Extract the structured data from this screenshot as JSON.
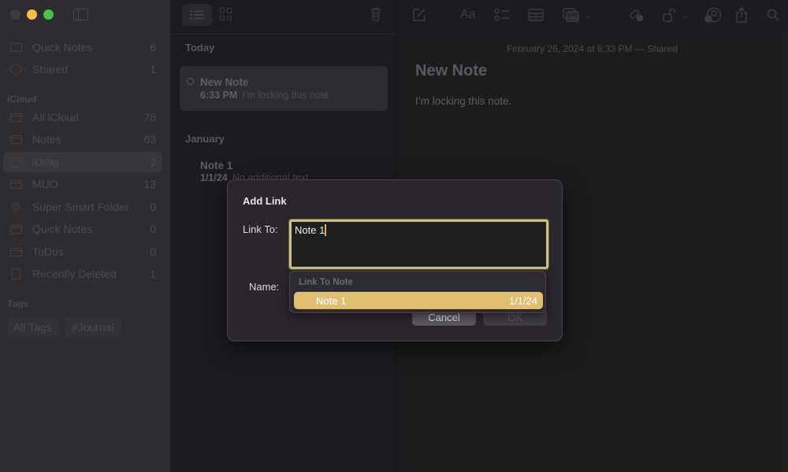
{
  "sidebar": {
    "pinned": [
      {
        "label": "Quick Notes",
        "count": "6",
        "icon": "quick-notes-icon"
      },
      {
        "label": "Shared",
        "count": "1",
        "icon": "shared-person-icon"
      }
    ],
    "section_icloud": "iCloud",
    "folders": [
      {
        "label": "All iCloud",
        "count": "78",
        "icon": "folder-icon"
      },
      {
        "label": "Notes",
        "count": "63",
        "icon": "folder-icon"
      },
      {
        "label": "iDrop",
        "count": "2",
        "icon": "folder-icon",
        "selected": true
      },
      {
        "label": "MUO",
        "count": "13",
        "icon": "folder-icon"
      },
      {
        "label": "Super Smart Folder",
        "count": "0",
        "icon": "gear-icon"
      },
      {
        "label": "Quick Notes",
        "count": "0",
        "icon": "folder-icon"
      },
      {
        "label": "ToDos",
        "count": "0",
        "icon": "folder-icon"
      },
      {
        "label": "Recently Deleted",
        "count": "1",
        "icon": "trash-icon"
      }
    ],
    "section_tags": "Tags",
    "tags": [
      "All Tags",
      "#Journal"
    ]
  },
  "notes_list": {
    "groups": [
      {
        "heading": "Today",
        "notes": [
          {
            "title": "New Note",
            "time": "6:33 PM",
            "preview": "I’m locking this note.",
            "shared": true
          }
        ]
      },
      {
        "heading": "January",
        "notes": [
          {
            "title": "Note 1",
            "time": "1/1/24",
            "preview": "No additional text"
          }
        ]
      }
    ]
  },
  "editor": {
    "meta": "February 26, 2024 at 6:33 PM — Shared",
    "title": "New Note",
    "body": "I’m locking this note.",
    "toolbar": [
      "compose-icon",
      "format-icon",
      "checklist-icon",
      "table-icon",
      "media-icon",
      "link-icon",
      "lock-icon",
      "collaborate-icon",
      "share-icon",
      "search-icon"
    ],
    "format_label": "Aa"
  },
  "dialog": {
    "title": "Add Link",
    "link_to_label": "Link To:",
    "link_to_value": "Note 1",
    "name_label": "Name:",
    "cancel_label": "Cancel",
    "ok_label": "OK",
    "suggestions": {
      "heading": "Link To Note",
      "items": [
        {
          "title": "Note 1",
          "date": "1/1/24",
          "highlighted": true
        }
      ]
    }
  },
  "colors": {
    "accent": "#e0c070",
    "traffic_min": "#f2be4f",
    "traffic_max": "#4cc049"
  }
}
